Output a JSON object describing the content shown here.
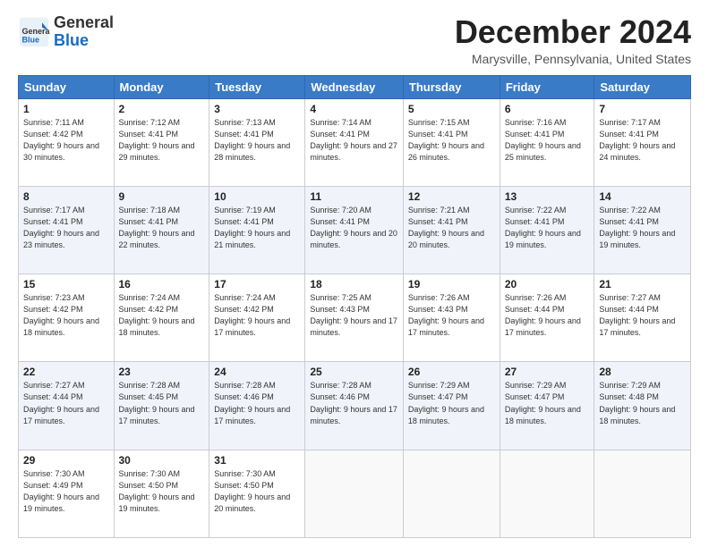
{
  "header": {
    "logo_general": "General",
    "logo_blue": "Blue",
    "month_title": "December 2024",
    "location": "Marysville, Pennsylvania, United States"
  },
  "days_of_week": [
    "Sunday",
    "Monday",
    "Tuesday",
    "Wednesday",
    "Thursday",
    "Friday",
    "Saturday"
  ],
  "weeks": [
    [
      {
        "day": "1",
        "sunrise": "7:11 AM",
        "sunset": "4:42 PM",
        "daylight": "9 hours and 30 minutes."
      },
      {
        "day": "2",
        "sunrise": "7:12 AM",
        "sunset": "4:41 PM",
        "daylight": "9 hours and 29 minutes."
      },
      {
        "day": "3",
        "sunrise": "7:13 AM",
        "sunset": "4:41 PM",
        "daylight": "9 hours and 28 minutes."
      },
      {
        "day": "4",
        "sunrise": "7:14 AM",
        "sunset": "4:41 PM",
        "daylight": "9 hours and 27 minutes."
      },
      {
        "day": "5",
        "sunrise": "7:15 AM",
        "sunset": "4:41 PM",
        "daylight": "9 hours and 26 minutes."
      },
      {
        "day": "6",
        "sunrise": "7:16 AM",
        "sunset": "4:41 PM",
        "daylight": "9 hours and 25 minutes."
      },
      {
        "day": "7",
        "sunrise": "7:17 AM",
        "sunset": "4:41 PM",
        "daylight": "9 hours and 24 minutes."
      }
    ],
    [
      {
        "day": "8",
        "sunrise": "7:17 AM",
        "sunset": "4:41 PM",
        "daylight": "9 hours and 23 minutes."
      },
      {
        "day": "9",
        "sunrise": "7:18 AM",
        "sunset": "4:41 PM",
        "daylight": "9 hours and 22 minutes."
      },
      {
        "day": "10",
        "sunrise": "7:19 AM",
        "sunset": "4:41 PM",
        "daylight": "9 hours and 21 minutes."
      },
      {
        "day": "11",
        "sunrise": "7:20 AM",
        "sunset": "4:41 PM",
        "daylight": "9 hours and 20 minutes."
      },
      {
        "day": "12",
        "sunrise": "7:21 AM",
        "sunset": "4:41 PM",
        "daylight": "9 hours and 20 minutes."
      },
      {
        "day": "13",
        "sunrise": "7:22 AM",
        "sunset": "4:41 PM",
        "daylight": "9 hours and 19 minutes."
      },
      {
        "day": "14",
        "sunrise": "7:22 AM",
        "sunset": "4:41 PM",
        "daylight": "9 hours and 19 minutes."
      }
    ],
    [
      {
        "day": "15",
        "sunrise": "7:23 AM",
        "sunset": "4:42 PM",
        "daylight": "9 hours and 18 minutes."
      },
      {
        "day": "16",
        "sunrise": "7:24 AM",
        "sunset": "4:42 PM",
        "daylight": "9 hours and 18 minutes."
      },
      {
        "day": "17",
        "sunrise": "7:24 AM",
        "sunset": "4:42 PM",
        "daylight": "9 hours and 17 minutes."
      },
      {
        "day": "18",
        "sunrise": "7:25 AM",
        "sunset": "4:43 PM",
        "daylight": "9 hours and 17 minutes."
      },
      {
        "day": "19",
        "sunrise": "7:26 AM",
        "sunset": "4:43 PM",
        "daylight": "9 hours and 17 minutes."
      },
      {
        "day": "20",
        "sunrise": "7:26 AM",
        "sunset": "4:44 PM",
        "daylight": "9 hours and 17 minutes."
      },
      {
        "day": "21",
        "sunrise": "7:27 AM",
        "sunset": "4:44 PM",
        "daylight": "9 hours and 17 minutes."
      }
    ],
    [
      {
        "day": "22",
        "sunrise": "7:27 AM",
        "sunset": "4:44 PM",
        "daylight": "9 hours and 17 minutes."
      },
      {
        "day": "23",
        "sunrise": "7:28 AM",
        "sunset": "4:45 PM",
        "daylight": "9 hours and 17 minutes."
      },
      {
        "day": "24",
        "sunrise": "7:28 AM",
        "sunset": "4:46 PM",
        "daylight": "9 hours and 17 minutes."
      },
      {
        "day": "25",
        "sunrise": "7:28 AM",
        "sunset": "4:46 PM",
        "daylight": "9 hours and 17 minutes."
      },
      {
        "day": "26",
        "sunrise": "7:29 AM",
        "sunset": "4:47 PM",
        "daylight": "9 hours and 18 minutes."
      },
      {
        "day": "27",
        "sunrise": "7:29 AM",
        "sunset": "4:47 PM",
        "daylight": "9 hours and 18 minutes."
      },
      {
        "day": "28",
        "sunrise": "7:29 AM",
        "sunset": "4:48 PM",
        "daylight": "9 hours and 18 minutes."
      }
    ],
    [
      {
        "day": "29",
        "sunrise": "7:30 AM",
        "sunset": "4:49 PM",
        "daylight": "9 hours and 19 minutes."
      },
      {
        "day": "30",
        "sunrise": "7:30 AM",
        "sunset": "4:50 PM",
        "daylight": "9 hours and 19 minutes."
      },
      {
        "day": "31",
        "sunrise": "7:30 AM",
        "sunset": "4:50 PM",
        "daylight": "9 hours and 20 minutes."
      },
      null,
      null,
      null,
      null
    ]
  ]
}
